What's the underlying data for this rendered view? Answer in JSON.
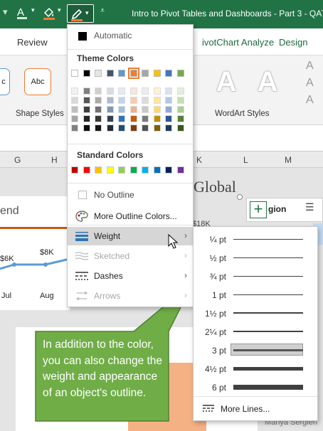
{
  "titlebar": {
    "title": "Intro to Pivot Tables and Dashboards - Part 3 - QAT",
    "icons": [
      "font-color-icon",
      "fill-color-icon",
      "shape-outline-icon",
      "customize-qat-icon"
    ],
    "accent": "#217346"
  },
  "menu": {
    "tabs": [
      "Review",
      "PivotChart Analyze",
      "Design"
    ],
    "review": "Review",
    "pivot_prefix": "ivotChart Analyze",
    "design": "Design"
  },
  "ribbon": {
    "shape_styles_label": "Shape Styles",
    "wordart_styles_label": "WordArt Styles",
    "abc": "Abc",
    "c": "c",
    "wordart_glyph": "A"
  },
  "sheet": {
    "columns": [
      "G",
      "H",
      "K",
      "L",
      "M"
    ],
    "title_fragment": "Global",
    "legend_fragment": "end",
    "region": "gion",
    "labels": {
      "k6": "$6K",
      "k8": "$8K",
      "k18": "$18K",
      "jul": "Jul",
      "aug": "Aug"
    },
    "name_fragment": "Mariya Sergien"
  },
  "outline_menu": {
    "automatic": "Automatic",
    "theme_colors": "Theme Colors",
    "standard_colors": "Standard Colors",
    "no_outline": "No Outline",
    "more_outline_colors": "More Outline Colors...",
    "weight": "Weight",
    "sketched": "Sketched",
    "dashes": "Dashes",
    "arrows": "Arrows",
    "theme_top": [
      "#ffffff",
      "#000000",
      "#e7e6e6",
      "#44546a",
      "#5b9bd5",
      "#ed7d31",
      "#a5a5a5",
      "#ffc000",
      "#4472c4",
      "#70ad47"
    ],
    "theme_shades": [
      [
        "#f2f2f2",
        "#d9d9d9",
        "#bfbfbf",
        "#a6a6a6",
        "#808080"
      ],
      [
        "#808080",
        "#595959",
        "#404040",
        "#262626",
        "#0d0d0d"
      ],
      [
        "#d0cece",
        "#aeaaaa",
        "#757171",
        "#3a3838",
        "#171616"
      ],
      [
        "#d6dce5",
        "#adb9ca",
        "#8497b0",
        "#333f50",
        "#222a35"
      ],
      [
        "#deebf7",
        "#bdd7ee",
        "#9dc3e6",
        "#2e75b6",
        "#1f4e79"
      ],
      [
        "#fbe5d6",
        "#f8cbad",
        "#f4b183",
        "#c55a11",
        "#843c0c"
      ],
      [
        "#ededed",
        "#dbdbdb",
        "#c9c9c9",
        "#7b7b7b",
        "#525252"
      ],
      [
        "#fff2cc",
        "#ffe699",
        "#ffd966",
        "#bf9000",
        "#7f6000"
      ],
      [
        "#dae3f3",
        "#b4c7e7",
        "#8faadc",
        "#2f5597",
        "#203864"
      ],
      [
        "#e2f0d9",
        "#c5e0b4",
        "#a9d18e",
        "#548235",
        "#385723"
      ]
    ],
    "standard": [
      "#c00000",
      "#ff0000",
      "#ffc000",
      "#ffff00",
      "#92d050",
      "#00b050",
      "#00b0f0",
      "#0070c0",
      "#002060",
      "#7030a0"
    ]
  },
  "weight_menu": {
    "weights": [
      "¼ pt",
      "½ pt",
      "¾ pt",
      "1 pt",
      "1½ pt",
      "2¼ pt",
      "3 pt",
      "4½ pt",
      "6 pt"
    ],
    "weight_values_pt": [
      0.25,
      0.5,
      0.75,
      1,
      1.5,
      2.25,
      3,
      4.5,
      6
    ],
    "selected": "3 pt",
    "more_lines": "More Lines..."
  },
  "callout": {
    "text": "In addition to the color, you can also change the weight and appearance of an object's outline.",
    "color": "#70ad47"
  }
}
